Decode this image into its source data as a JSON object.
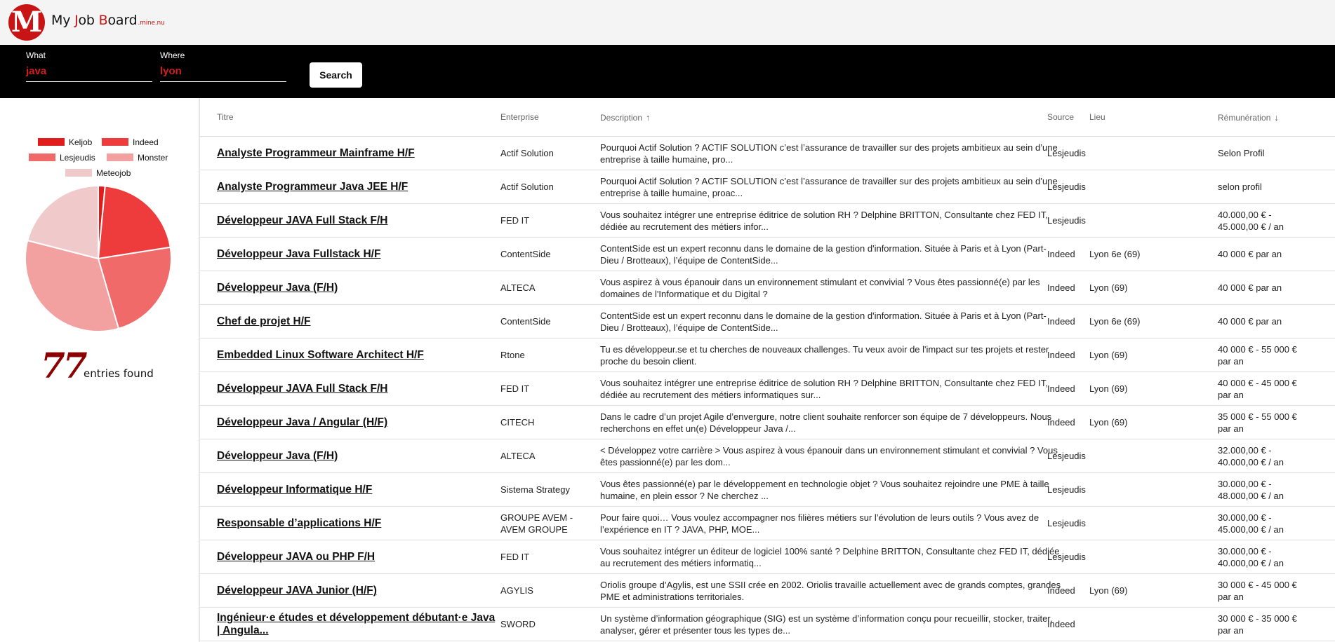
{
  "app": {
    "logo_letter": "M",
    "brand_my": "My ",
    "brand_j": "J",
    "brand_ob": "ob ",
    "brand_board": "Board",
    "brand_domain": ".mine.nu"
  },
  "search": {
    "what_label": "What",
    "what_value": "java",
    "where_label": "Where",
    "where_value": "lyon",
    "button_label": "Search"
  },
  "sidebar": {
    "legend": [
      {
        "label": "Keljob",
        "color": "#e01c1c"
      },
      {
        "label": "Indeed",
        "color": "#ee3b3b"
      },
      {
        "label": "Lesjeudis",
        "color": "#f06a6a"
      },
      {
        "label": "Monster",
        "color": "#f2a0a0"
      },
      {
        "label": "Meteojob",
        "color": "#f0caca"
      }
    ],
    "count": "77",
    "count_label": "entries found"
  },
  "chart_data": {
    "type": "pie",
    "categories": [
      "Keljob",
      "Indeed",
      "Lesjeudis",
      "Monster",
      "Meteojob"
    ],
    "values": [
      1.5,
      21,
      23,
      33.5,
      21
    ],
    "colors": [
      "#e01c1c",
      "#ee3b3b",
      "#f06a6a",
      "#f2a0a0",
      "#f0caca"
    ]
  },
  "table": {
    "headers": {
      "titre": "Titre",
      "entreprise": "Enterprise",
      "description": "Description",
      "source": "Source",
      "lieu": "Lieu",
      "remuneration": "Rémunération"
    },
    "rows": [
      {
        "titre": "Analyste Programmeur Mainframe H/F",
        "entreprise": "Actif Solution",
        "description": "Pourquoi Actif Solution ? ACTIF SOLUTION c’est l’assurance de travailler sur des projets ambitieux au sein d’une entreprise à taille humaine, pro...",
        "source": "Lesjeudis",
        "lieu": "",
        "remuneration": "Selon Profil"
      },
      {
        "titre": "Analyste Programmeur Java JEE H/F",
        "entreprise": "Actif Solution",
        "description": "Pourquoi Actif Solution ? ACTIF SOLUTION c’est l’assurance de travailler sur des projets ambitieux au sein d’une entreprise à taille humaine, proac...",
        "source": "Lesjeudis",
        "lieu": "",
        "remuneration": "selon profil"
      },
      {
        "titre": "Développeur JAVA Full Stack F/H",
        "entreprise": "FED IT",
        "description": "Vous souhaitez intégrer une entreprise éditrice de solution RH ? Delphine BRITTON, Consultante chez FED IT, dédiée au recrutement des métiers infor...",
        "source": "Lesjeudis",
        "lieu": "",
        "remuneration": "40.000,00 € - 45.000,00 € / an"
      },
      {
        "titre": "Développeur Java Fullstack H/F",
        "entreprise": "ContentSide",
        "description": "ContentSide est un expert reconnu dans le domaine de la gestion d'information. Située à Paris et à Lyon (Part-Dieu / Brotteaux), l’équipe de ContentSide...",
        "source": "Indeed",
        "lieu": "Lyon 6e (69)",
        "remuneration": "40 000 € par an"
      },
      {
        "titre": "Développeur Java (F/H)",
        "entreprise": "ALTECA",
        "description": "Vous aspirez à vous épanouir dans un environnement stimulant et convivial ? Vous êtes passionné(e) par les domaines de l'Informatique et du Digital ?",
        "source": "Indeed",
        "lieu": "Lyon (69)",
        "remuneration": "40 000 € par an"
      },
      {
        "titre": "Chef de projet H/F",
        "entreprise": "ContentSide",
        "description": "ContentSide est un expert reconnu dans le domaine de la gestion d'information. Située à Paris et à Lyon (Part-Dieu / Brotteaux), l’équipe de ContentSide...",
        "source": "Indeed",
        "lieu": "Lyon 6e (69)",
        "remuneration": "40 000 € par an"
      },
      {
        "titre": "Embedded Linux Software Architect H/F",
        "entreprise": "Rtone",
        "description": "Tu es développeur.se et tu cherches de nouveaux challenges. Tu veux avoir de l'impact sur tes projets et rester proche du besoin client.",
        "source": "Indeed",
        "lieu": "Lyon (69)",
        "remuneration": "40 000 € - 55 000 € par an"
      },
      {
        "titre": "Développeur JAVA Full Stack F/H",
        "entreprise": "FED IT",
        "description": "Vous souhaitez intégrer une entreprise éditrice de solution RH ? Delphine BRITTON, Consultante chez FED IT, dédiée au recrutement des métiers informatiques sur...",
        "source": "Indeed",
        "lieu": "Lyon (69)",
        "remuneration": "40 000 € - 45 000 € par an"
      },
      {
        "titre": "Développeur Java / Angular (H/F)",
        "entreprise": "CITECH",
        "description": "Dans le cadre d’un projet Agile d’envergure, notre client souhaite renforcer son équipe de 7 développeurs. Nous recherchons en effet un(e) Développeur Java /...",
        "source": "Indeed",
        "lieu": "Lyon (69)",
        "remuneration": "35 000 € - 55 000 € par an"
      },
      {
        "titre": "Développeur Java (F/H)",
        "entreprise": "ALTECA",
        "description": "< Développez votre carrière > Vous aspirez à vous épanouir dans un environnement stimulant et convivial ? Vous êtes passionné(e) par les dom...",
        "source": "Lesjeudis",
        "lieu": "",
        "remuneration": "32.000,00 € - 40.000,00 € / an"
      },
      {
        "titre": "Développeur Informatique H/F",
        "entreprise": "Sistema Strategy",
        "description": "Vous êtes passionné(e) par le développement en technologie objet ? Vous souhaitez rejoindre une PME à taille humaine, en plein essor ? Ne cherchez ...",
        "source": "Lesjeudis",
        "lieu": "",
        "remuneration": "30.000,00 € - 48.000,00 € / an"
      },
      {
        "titre": "Responsable d’applications H/F",
        "entreprise": "GROUPE AVEM - AVEM GROUPE",
        "description": "Pour faire quoi… Vous voulez accompagner nos filières métiers sur l’évolution de leurs outils ? Vous avez de l’expérience en IT ? JAVA, PHP, MOE...",
        "source": "Lesjeudis",
        "lieu": "",
        "remuneration": "30.000,00 € - 45.000,00 € / an"
      },
      {
        "titre": "Développeur JAVA ou PHP F/H",
        "entreprise": "FED IT",
        "description": "Vous souhaitez intégrer un éditeur de logiciel 100% santé ? Delphine BRITTON, Consultante chez FED IT, dédiée au recrutement des métiers informatiq...",
        "source": "Lesjeudis",
        "lieu": "",
        "remuneration": "30.000,00 € - 40.000,00 € / an"
      },
      {
        "titre": "Développeur JAVA Junior (H/F)",
        "entreprise": "AGYLIS",
        "description": "Oriolis groupe d’Agylis, est une SSII crée en 2002. Oriolis travaille actuellement avec de grands comptes, grandes PME et administrations territoriales.",
        "source": "Indeed",
        "lieu": "Lyon (69)",
        "remuneration": "30 000 € - 45 000 € par an"
      },
      {
        "titre": "Ingénieur·e études et développement débutant·e Java | Angula...",
        "entreprise": "SWORD",
        "description": "Un système d’information géographique (SIG) est un système d’information conçu pour recueillir, stocker, traiter, analyser, gérer et présenter tous les types de...",
        "source": "Indeed",
        "lieu": "",
        "remuneration": "30 000 € - 35 000 € par an"
      }
    ]
  }
}
